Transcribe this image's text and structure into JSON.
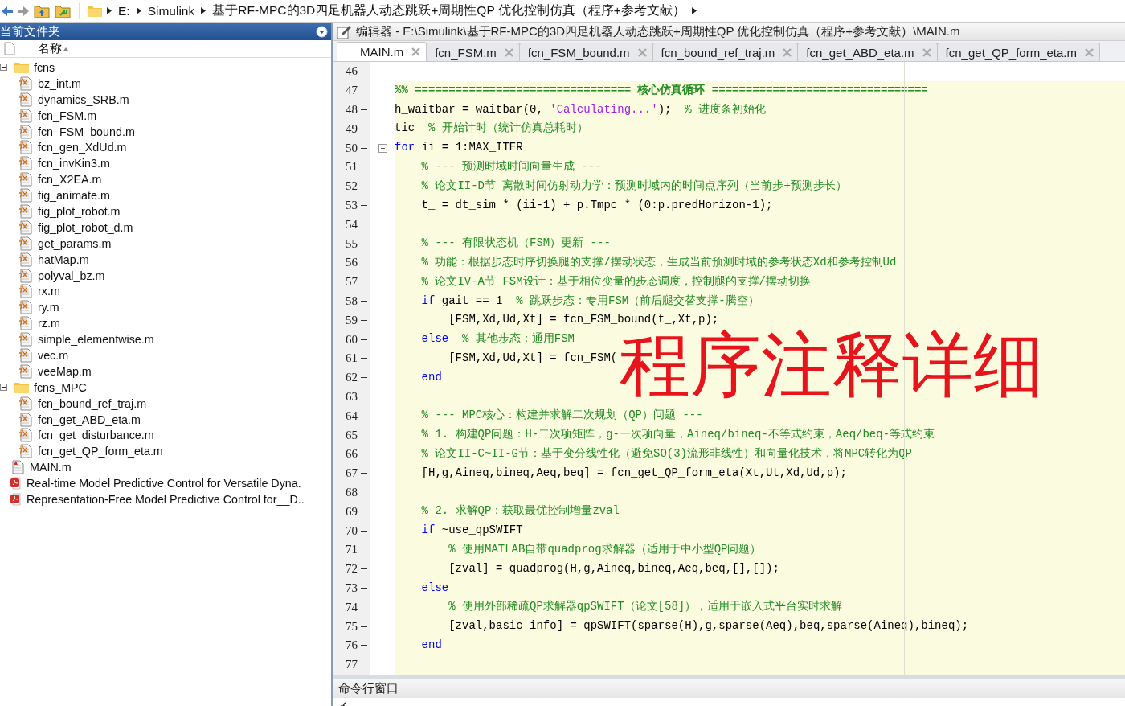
{
  "address_bar": {
    "segments": [
      "E:",
      "Simulink",
      "基于RF-MPC的3D四足机器人动态跳跃+周期性QP 优化控制仿真（程序+参考文献）"
    ]
  },
  "current_folder": {
    "title": "当前文件夹",
    "column": "名称",
    "tree": [
      {
        "name": "fcns",
        "kind": "folder",
        "expanded": true,
        "children": [
          {
            "name": "bz_int.m",
            "kind": "function"
          },
          {
            "name": "dynamics_SRB.m",
            "kind": "function"
          },
          {
            "name": "fcn_FSM.m",
            "kind": "function"
          },
          {
            "name": "fcn_FSM_bound.m",
            "kind": "function"
          },
          {
            "name": "fcn_gen_XdUd.m",
            "kind": "function"
          },
          {
            "name": "fcn_invKin3.m",
            "kind": "function"
          },
          {
            "name": "fcn_X2EA.m",
            "kind": "function"
          },
          {
            "name": "fig_animate.m",
            "kind": "function"
          },
          {
            "name": "fig_plot_robot.m",
            "kind": "function"
          },
          {
            "name": "fig_plot_robot_d.m",
            "kind": "function"
          },
          {
            "name": "get_params.m",
            "kind": "function"
          },
          {
            "name": "hatMap.m",
            "kind": "function"
          },
          {
            "name": "polyval_bz.m",
            "kind": "function"
          },
          {
            "name": "rx.m",
            "kind": "function"
          },
          {
            "name": "ry.m",
            "kind": "function"
          },
          {
            "name": "rz.m",
            "kind": "function"
          },
          {
            "name": "simple_elementwise.m",
            "kind": "function"
          },
          {
            "name": "vec.m",
            "kind": "function"
          },
          {
            "name": "veeMap.m",
            "kind": "function"
          }
        ]
      },
      {
        "name": "fcns_MPC",
        "kind": "folder",
        "expanded": true,
        "children": [
          {
            "name": "fcn_bound_ref_traj.m",
            "kind": "function"
          },
          {
            "name": "fcn_get_ABD_eta.m",
            "kind": "function"
          },
          {
            "name": "fcn_get_disturbance.m",
            "kind": "function"
          },
          {
            "name": "fcn_get_QP_form_eta.m",
            "kind": "function"
          }
        ]
      },
      {
        "name": "MAIN.m",
        "kind": "script"
      },
      {
        "name": "Real-time Model Predictive Control for Versatile Dyna.",
        "kind": "pdf"
      },
      {
        "name": "Representation-Free Model Predictive Control for__D..",
        "kind": "pdf"
      }
    ]
  },
  "editor": {
    "title": "编辑器 - E:\\Simulink\\基于RF-MPC的3D四足机器人动态跳跃+周期性QP 优化控制仿真（程序+参考文献）\\MAIN.m",
    "tabs": [
      {
        "label": "MAIN.m",
        "selected": true
      },
      {
        "label": "fcn_FSM.m",
        "selected": false
      },
      {
        "label": "fcn_FSM_bound.m",
        "selected": false
      },
      {
        "label": "fcn_bound_ref_traj.m",
        "selected": false
      },
      {
        "label": "fcn_get_ABD_eta.m",
        "selected": false
      },
      {
        "label": "fcn_get_QP_form_eta.m",
        "selected": false
      }
    ],
    "lines": [
      {
        "number": "46",
        "executable": false,
        "fold": false,
        "in_cell": false
      },
      {
        "number": "47",
        "executable": false,
        "fold": false,
        "in_cell": true,
        "segments": [
          {
            "kind": "section",
            "text": "%% ================================ 核心仿真循环 ================================"
          }
        ]
      },
      {
        "number": "48",
        "executable": true,
        "fold": false,
        "in_cell": true,
        "segments": [
          {
            "kind": "code",
            "text": "h_waitbar = waitbar(0,"
          },
          {
            "kind": "string",
            "text": "'Calculating...'"
          },
          {
            "kind": "code",
            "text": ");"
          },
          {
            "kind": "comment",
            "text": "% 进度条初始化"
          }
        ]
      },
      {
        "number": "49",
        "executable": true,
        "fold": false,
        "in_cell": true,
        "segments": [
          {
            "kind": "code",
            "text": "tic"
          },
          {
            "kind": "comment",
            "text": "% 开始计时（统计仿真总耗时）"
          }
        ]
      },
      {
        "number": "50",
        "executable": true,
        "fold": true,
        "in_cell": true,
        "segments": [
          {
            "kind": "keyword",
            "text": "for"
          },
          {
            "kind": "code",
            "text": "ii = 1:MAX_ITER"
          }
        ],
        "children": [
          {
            "number": "51",
            "executable": false,
            "fold": false,
            "in_cell": true,
            "segments": [
              {
                "kind": "comment",
                "text": "% --- 预测时域时间向量生成 ---"
              }
            ]
          },
          {
            "number": "52",
            "executable": false,
            "fold": false,
            "in_cell": true,
            "segments": [
              {
                "kind": "comment",
                "text": "% 论文II-D节 离散时间仿射动力学：预测时域内的时间点序列（当前步+预测步长）"
              }
            ]
          },
          {
            "number": "53",
            "executable": true,
            "fold": false,
            "in_cell": true,
            "segments": [
              {
                "kind": "code",
                "text": "t_ = dt_sim * (ii-1) + p.Tmpc * (0:p.predHorizon-1);"
              }
            ]
          },
          {
            "number": "54",
            "executable": false,
            "fold": false,
            "in_cell": true
          },
          {
            "number": "55",
            "executable": false,
            "fold": false,
            "in_cell": true,
            "segments": [
              {
                "kind": "comment",
                "text": "% --- 有限状态机（FSM）更新 ---"
              }
            ]
          },
          {
            "number": "56",
            "executable": false,
            "fold": false,
            "in_cell": true,
            "segments": [
              {
                "kind": "comment",
                "text": "% 功能：根据步态时序切换腿的支撑/摆动状态，生成当前预测时域的参考状态Xd和参考控制Ud"
              }
            ]
          },
          {
            "number": "57",
            "executable": false,
            "fold": false,
            "in_cell": true,
            "segments": [
              {
                "kind": "comment",
                "text": "% 论文IV-A节 FSM设计：基于相位变量的步态调度，控制腿的支撑/摆动切换"
              }
            ]
          },
          {
            "number": "58",
            "executable": true,
            "fold": false,
            "in_cell": true,
            "segments": [
              {
                "kind": "keyword",
                "text": "if"
              },
              {
                "kind": "code",
                "text": "gait == 1"
              },
              {
                "kind": "comment",
                "text": "% 跳跃步态：专用FSM（前后腿交替支撑-腾空）"
              }
            ],
            "children": [
              {
                "number": "59",
                "executable": true,
                "fold": false,
                "in_cell": true,
                "segments": [
                  {
                    "kind": "code",
                    "text": "[FSM,Xd,Ud,Xt] = fcn_FSM_bound(t_,Xt,p);"
                  }
                ]
              }
            ]
          },
          {
            "number": "60",
            "executable": true,
            "fold": false,
            "in_cell": true,
            "segments": [
              {
                "kind": "keyword",
                "text": "else"
              },
              {
                "kind": "comment",
                "text": "% 其他步态：通用FSM"
              }
            ],
            "children": [
              {
                "number": "61",
                "executable": true,
                "fold": false,
                "in_cell": true,
                "segments": [
                  {
                    "kind": "code",
                    "text": "[FSM,Xd,Ud,Xt] = fcn_FSM("
                  }
                ]
              }
            ]
          },
          {
            "number": "62",
            "executable": true,
            "fold": false,
            "in_cell": true,
            "segments": [
              {
                "kind": "keyword",
                "text": "end"
              }
            ]
          },
          {
            "number": "63",
            "executable": false,
            "fold": false,
            "in_cell": true
          },
          {
            "number": "64",
            "executable": false,
            "fold": false,
            "in_cell": true,
            "segments": [
              {
                "kind": "comment",
                "text": "% --- MPC核心：构建并求解二次规划（QP）问题 ---"
              }
            ]
          },
          {
            "number": "65",
            "executable": false,
            "fold": false,
            "in_cell": true,
            "segments": [
              {
                "kind": "comment",
                "text": "% 1. 构建QP问题：H-二次项矩阵，g-一次项向量，Aineq/bineq-不等式约束，Aeq/beq-等式约束"
              }
            ]
          },
          {
            "number": "66",
            "executable": false,
            "fold": false,
            "in_cell": true,
            "segments": [
              {
                "kind": "comment",
                "text": "% 论文II-C~II-G节：基于变分线性化（避免SO(3)流形非线性）和向量化技术，将MPC转化为QP"
              }
            ]
          },
          {
            "number": "67",
            "executable": true,
            "fold": false,
            "in_cell": true,
            "segments": [
              {
                "kind": "code",
                "text": "[H,g,Aineq,bineq,Aeq,beq] = fcn_get_QP_form_eta(Xt,Ut,Xd,Ud,p);"
              }
            ]
          },
          {
            "number": "68",
            "executable": false,
            "fold": false,
            "in_cell": true
          },
          {
            "number": "69",
            "executable": false,
            "fold": false,
            "in_cell": true,
            "segments": [
              {
                "kind": "comment",
                "text": "% 2. 求解QP：获取最优控制增量zval"
              }
            ]
          },
          {
            "number": "70",
            "executable": true,
            "fold": false,
            "in_cell": true,
            "segments": [
              {
                "kind": "keyword",
                "text": "if"
              },
              {
                "kind": "code",
                "text": "~use_qpSWIFT"
              }
            ],
            "children": [
              {
                "number": "71",
                "executable": false,
                "fold": false,
                "in_cell": true,
                "segments": [
                  {
                    "kind": "comment",
                    "text": "% 使用MATLAB自带quadprog求解器（适用于中小型QP问题）"
                  }
                ]
              },
              {
                "number": "72",
                "executable": true,
                "fold": false,
                "in_cell": true,
                "segments": [
                  {
                    "kind": "code",
                    "text": "[zval] = quadprog(H,g,Aineq,bineq,Aeq,beq,[],[]);"
                  }
                ]
              }
            ]
          },
          {
            "number": "73",
            "executable": true,
            "fold": false,
            "in_cell": true,
            "segments": [
              {
                "kind": "keyword",
                "text": "else"
              }
            ],
            "children": [
              {
                "number": "74",
                "executable": false,
                "fold": false,
                "in_cell": true,
                "segments": [
                  {
                    "kind": "comment",
                    "text": "% 使用外部稀疏QP求解器qpSWIFT（论文[58]），适用于嵌入式平台实时求解"
                  }
                ]
              },
              {
                "number": "75",
                "executable": true,
                "fold": false,
                "in_cell": true,
                "segments": [
                  {
                    "kind": "code",
                    "text": "[zval,basic_info] = qpSWIFT(sparse(H),g,sparse(Aeq),beq,sparse(Aineq),bineq);"
                  }
                ]
              }
            ]
          },
          {
            "number": "76",
            "executable": true,
            "fold": false,
            "in_cell": true,
            "segments": [
              {
                "kind": "keyword",
                "text": "end"
              }
            ]
          }
        ]
      },
      {
        "number": "77",
        "executable": false,
        "fold": false,
        "in_cell": true
      }
    ]
  },
  "overlay_text": "程序注释详细",
  "command_window": {
    "title": "命令行窗口"
  }
}
